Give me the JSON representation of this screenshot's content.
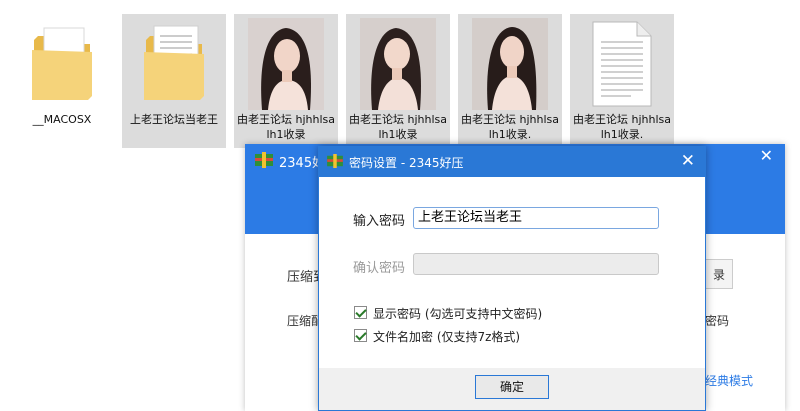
{
  "files": [
    {
      "label": "__MACOSX",
      "type": "folder"
    },
    {
      "label": "上老王论坛当老王",
      "type": "folder"
    },
    {
      "label": "由老王论坛 hjhhlsalh1收录",
      "type": "image"
    },
    {
      "label": "由老王论坛 hjhhlsalh1收录",
      "type": "image"
    },
    {
      "label": "由老王论坛 hjhhlsalh1收录.",
      "type": "image"
    },
    {
      "label": "由老王论坛 hjhhlsalh1收录.",
      "type": "document"
    }
  ],
  "bg_window": {
    "title": "2345好",
    "label1": "压缩到",
    "label2": "压缩配",
    "button_fragment": "录",
    "right_fragment": "密码",
    "link": "经典模式"
  },
  "dialog": {
    "title": "密码设置 - 2345好压",
    "close_glyph": "✕",
    "password_label": "输入密码",
    "password_value": "上老王论坛当老王",
    "confirm_label": "确认密码",
    "confirm_value": "",
    "show_password_label": "显示密码 (勾选可支持中文密码)",
    "show_password_checked": true,
    "encrypt_names_label": "文件名加密  (仅支持7z格式)",
    "encrypt_names_checked": true,
    "ok_label": "确定"
  },
  "colors": {
    "accent": "#2a78d6",
    "folder": "#f5d37a",
    "window_blue": "#2c7be5"
  }
}
